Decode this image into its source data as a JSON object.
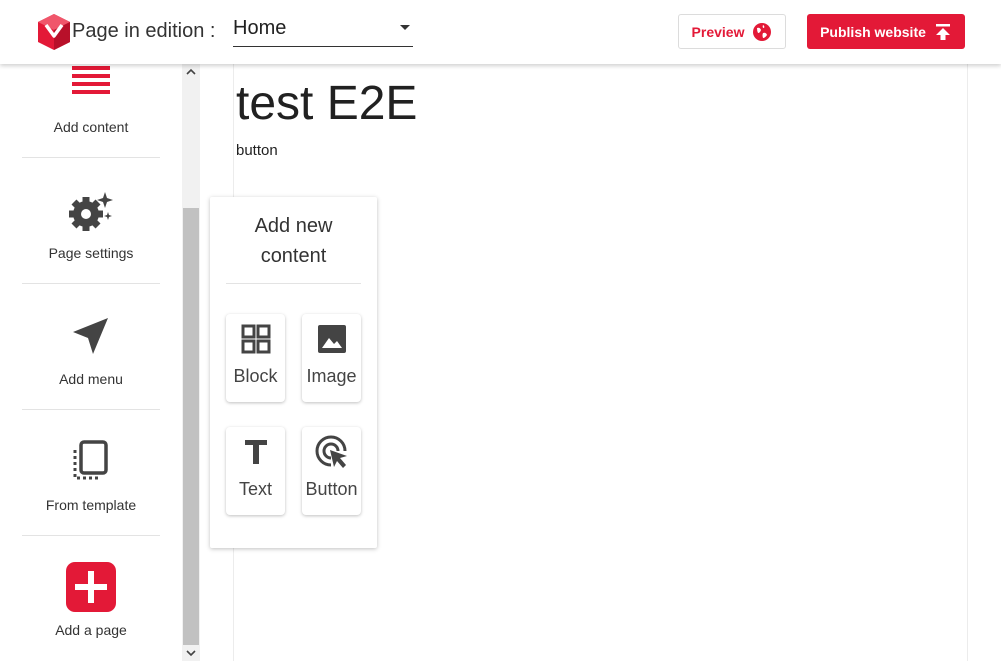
{
  "header": {
    "edition_label": "Page in edition :",
    "selected_page": "Home",
    "preview_label": "Preview",
    "publish_label": "Publish website",
    "accent_color": "#e31937"
  },
  "sidebar": {
    "items": [
      {
        "label": "Add content",
        "icon": "menu-lines-icon"
      },
      {
        "label": "Page settings",
        "icon": "gears-sparkle-icon"
      },
      {
        "label": "Add menu",
        "icon": "navigation-arrow-icon"
      },
      {
        "label": "From template",
        "icon": "template-copy-icon"
      },
      {
        "label": "Add a page",
        "icon": "plus-box-icon"
      }
    ]
  },
  "page": {
    "heading": "test E2E",
    "text": "button"
  },
  "add_content_popup": {
    "title": "Add new content",
    "tiles": [
      {
        "label": "Block",
        "icon": "grid-icon"
      },
      {
        "label": "Image",
        "icon": "image-icon"
      },
      {
        "label": "Text",
        "icon": "text-t-icon"
      },
      {
        "label": "Button",
        "icon": "cursor-click-icon"
      }
    ]
  }
}
